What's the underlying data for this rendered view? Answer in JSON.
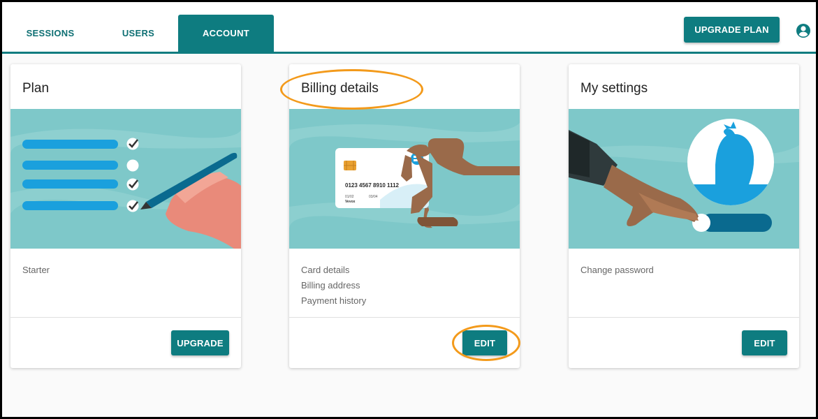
{
  "header": {
    "tabs": [
      {
        "label": "SESSIONS",
        "active": false
      },
      {
        "label": "USERS",
        "active": false
      },
      {
        "label": "ACCOUNT",
        "active": true
      }
    ],
    "upgrade_plan_label": "UPGRADE PLAN",
    "account_icon": "account-circle-icon"
  },
  "cards": [
    {
      "title": "Plan",
      "illustration": "checklist-pen-illustration",
      "items": [
        "Starter"
      ],
      "button_label": "UPGRADE"
    },
    {
      "title": "Billing details",
      "illustration": "credit-card-hand-illustration",
      "card_number": "0123 4567 8910 1112",
      "card_valid_from": "01/02",
      "card_valid_to": "03/04",
      "card_name": "Vevox",
      "items": [
        "Card details",
        "Billing address",
        "Payment history"
      ],
      "button_label": "EDIT"
    },
    {
      "title": "My settings",
      "illustration": "toggle-switch-hand-illustration",
      "items": [
        "Change password"
      ],
      "button_label": "EDIT"
    }
  ],
  "colors": {
    "accent": "#0e7c80",
    "illustration_bg": "#7ec8c9",
    "annotation": "#f39a1b",
    "blue_bar": "#1aa0dd"
  }
}
